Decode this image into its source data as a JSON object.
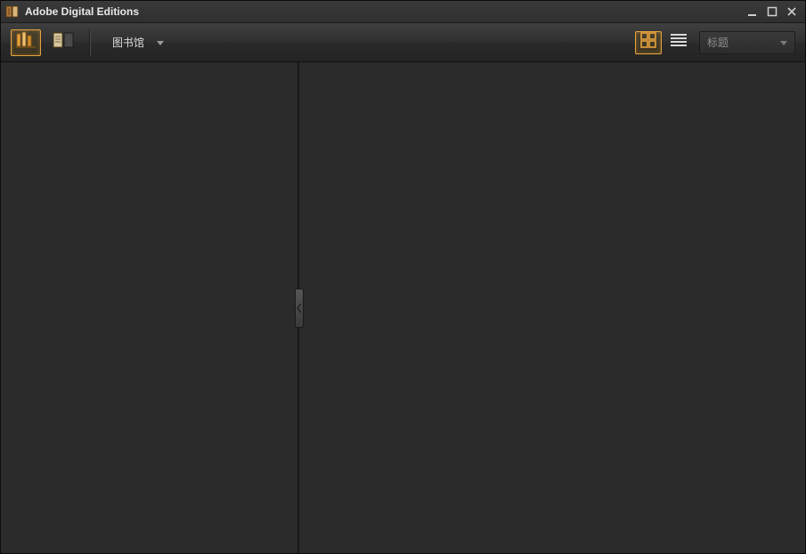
{
  "titlebar": {
    "app_title": "Adobe Digital Editions"
  },
  "toolbar": {
    "library_menu_label": "图书馆",
    "sort_label": "标题"
  },
  "icons": {
    "library_view": "library-shelf-icon",
    "reading_view": "reading-page-icon",
    "thumbnail_view": "thumbnail-grid-icon",
    "list_view": "list-lines-icon"
  },
  "colors": {
    "accent": "#e8a33d",
    "panel_bg": "#2b2b2b",
    "toolbar_bg": "#303030",
    "text_muted": "#8e8e8e",
    "text": "#dcdcdc"
  }
}
